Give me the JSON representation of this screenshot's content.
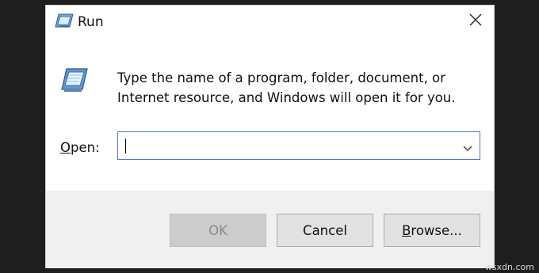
{
  "window": {
    "title": "Run"
  },
  "description": {
    "line1": "Type the name of a program, folder, document, or",
    "line2": "Internet resource, and Windows will open it for you."
  },
  "open_field": {
    "label": "Open:",
    "label_accel": "O",
    "label_rest": "pen:",
    "value": ""
  },
  "buttons": {
    "ok": "OK",
    "cancel": "Cancel",
    "browse": "Browse...",
    "browse_accel": "B",
    "browse_rest": "rowse..."
  },
  "icons": [
    "run-icon",
    "close-icon",
    "chevron-down-icon"
  ],
  "colors": {
    "input_border": "#4a7cc6",
    "footer": "#f0f0f0",
    "ok_disabled_bg": "#cccccc"
  },
  "watermark": "wsxdn.com"
}
